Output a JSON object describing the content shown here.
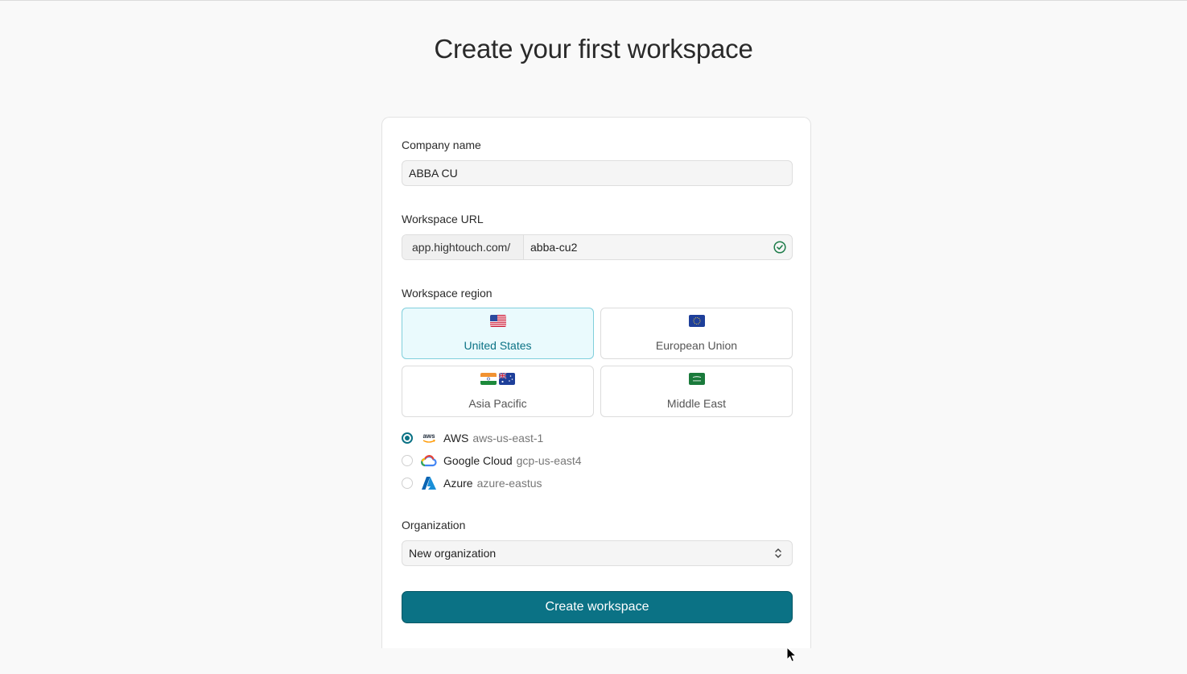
{
  "page": {
    "title": "Create your first workspace"
  },
  "form": {
    "company_label": "Company name",
    "company_value": "ABBA CU",
    "url_label": "Workspace URL",
    "url_prefix": "app.hightouch.com/",
    "url_value": "abba-cu2",
    "region_label": "Workspace region",
    "regions": [
      {
        "name": "United States",
        "selected": true
      },
      {
        "name": "European Union",
        "selected": false
      },
      {
        "name": "Asia Pacific",
        "selected": false
      },
      {
        "name": "Middle East",
        "selected": false
      }
    ],
    "clouds": [
      {
        "provider": "AWS",
        "region": "aws-us-east-1",
        "selected": true,
        "icon": "aws-icon"
      },
      {
        "provider": "Google Cloud",
        "region": "gcp-us-east4",
        "selected": false,
        "icon": "google-cloud-icon"
      },
      {
        "provider": "Azure",
        "region": "azure-eastus",
        "selected": false,
        "icon": "azure-icon"
      }
    ],
    "org_label": "Organization",
    "org_value": "New organization",
    "submit_label": "Create workspace"
  },
  "colors": {
    "accent": "#0b7285",
    "selected_bg": "#eafafd",
    "valid_green": "#1e7d4a"
  }
}
